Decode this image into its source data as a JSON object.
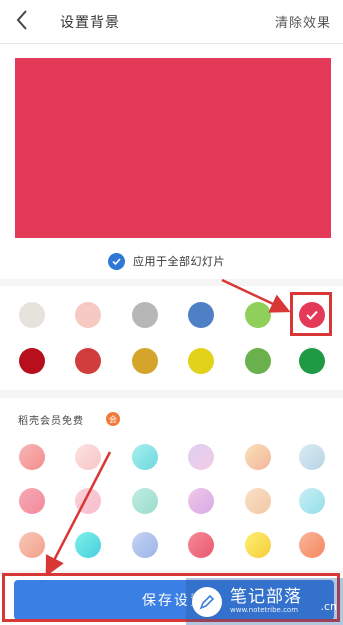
{
  "header": {
    "title": "设置背景",
    "clear_label": "清除效果"
  },
  "preview": {
    "color": "#e5395a"
  },
  "apply_all": {
    "label": "应用于全部幻灯片",
    "checked": true
  },
  "solid_colors": [
    "#e5e3dc",
    "#f6c9c3",
    "#b7b7b7",
    "#4f7fc4",
    "#8fd05a",
    "#e5395a",
    "#b80f1c",
    "#d13c3c",
    "#d4a52a",
    "#e3d21a",
    "#6ab04c",
    "#1e9a45"
  ],
  "selected_solid_index": 5,
  "member_section": {
    "label": "稻壳会员免费",
    "badge": "会"
  },
  "gradients": [
    [
      "#f7b7b7",
      "#f48c8c"
    ],
    [
      "#fde2e2",
      "#f7c5c5"
    ],
    [
      "#a8f0f0",
      "#6cd8dc"
    ],
    [
      "#dcd0f2",
      "#f4cbe5"
    ],
    [
      "#f9e2b8",
      "#f2b49a"
    ],
    [
      "#d8ecf2",
      "#b8d3e6"
    ],
    [
      "#f8a9b4",
      "#f08a9c"
    ],
    [
      "#fbd2d8",
      "#f6bccc"
    ],
    [
      "#c0ece2",
      "#9adccd"
    ],
    [
      "#f0c8e8",
      "#d7a9e6"
    ],
    [
      "#fae0c8",
      "#f2c7a4"
    ],
    [
      "#c8f0f4",
      "#94dde8"
    ],
    [
      "#f7c8b8",
      "#f3a08a"
    ],
    [
      "#7ef0e6",
      "#47cfe0"
    ],
    [
      "#c7d3f4",
      "#9ab4e8"
    ],
    [
      "#f58a98",
      "#e9596e"
    ],
    [
      "#fdf073",
      "#f5cc3a"
    ],
    [
      "#fbb59a",
      "#f4875e"
    ]
  ],
  "save": {
    "label": "保存设置"
  },
  "watermark": {
    "name": "笔记部落",
    "url": "www.notetribe.com",
    "suffix": ".cn"
  },
  "annotation_color": "#d93636"
}
